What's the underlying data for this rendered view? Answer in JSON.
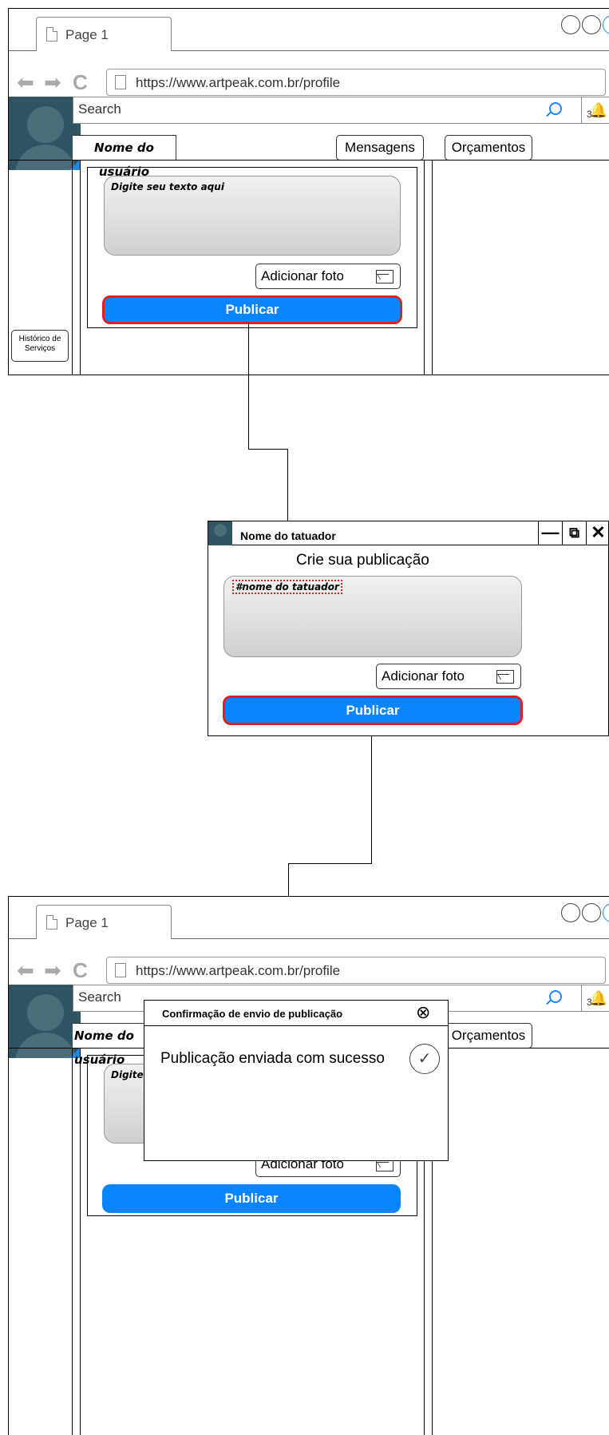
{
  "browser": {
    "tab_label": "Page 1",
    "url": "https://www.artpeak.com.br/profile",
    "search_placeholder": "Search",
    "notification_count": "3"
  },
  "profile": {
    "username": "Nome do usuário",
    "messages_button": "Mensagens",
    "quotes_button": "Orçamentos",
    "history_button": "Histórico de Serviços"
  },
  "composer": {
    "textarea_placeholder": "Digite seu texto aqui",
    "add_photo": "Adicionar foto",
    "publish": "Publicar"
  },
  "dialog": {
    "title": "Nome do tatuador",
    "heading": "Crie sua publicação",
    "tag_text": "#nome do tatuador",
    "add_photo": "Adicionar foto",
    "publish": "Publicar",
    "controls": [
      "—",
      "⧉",
      "✕"
    ]
  },
  "confirmation": {
    "title": "Confirmação de envio de publicação",
    "message": "Publicação enviada com sucesso",
    "close_icon": "⊗",
    "check_icon": "✓"
  },
  "colors": {
    "accent": "#0a84ff",
    "highlight_border": "#e02020",
    "avatar_bg": "#2f5564"
  }
}
